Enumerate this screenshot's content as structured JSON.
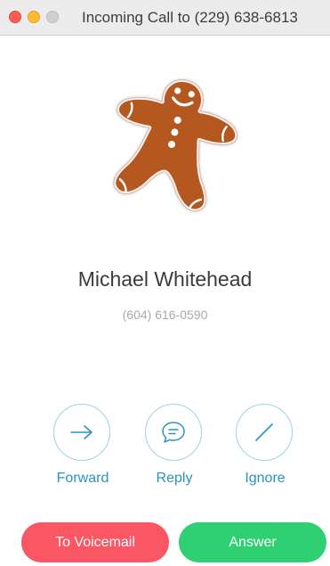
{
  "window": {
    "title": "Incoming Call to (229) 638-6813"
  },
  "caller": {
    "name": "Michael Whitehead",
    "number": "(604) 616-0590",
    "avatar_icon": "gingerbread-man"
  },
  "actions": [
    {
      "label": "Forward",
      "icon": "arrow-right-icon"
    },
    {
      "label": "Reply",
      "icon": "speech-bubble-icon"
    },
    {
      "label": "Ignore",
      "icon": "slash-icon"
    }
  ],
  "buttons": {
    "voicemail_label": "To Voicemail",
    "answer_label": "Answer"
  },
  "colors": {
    "accent": "#2a93c4",
    "voicemail": "#fb5664",
    "answer": "#2ed072"
  }
}
